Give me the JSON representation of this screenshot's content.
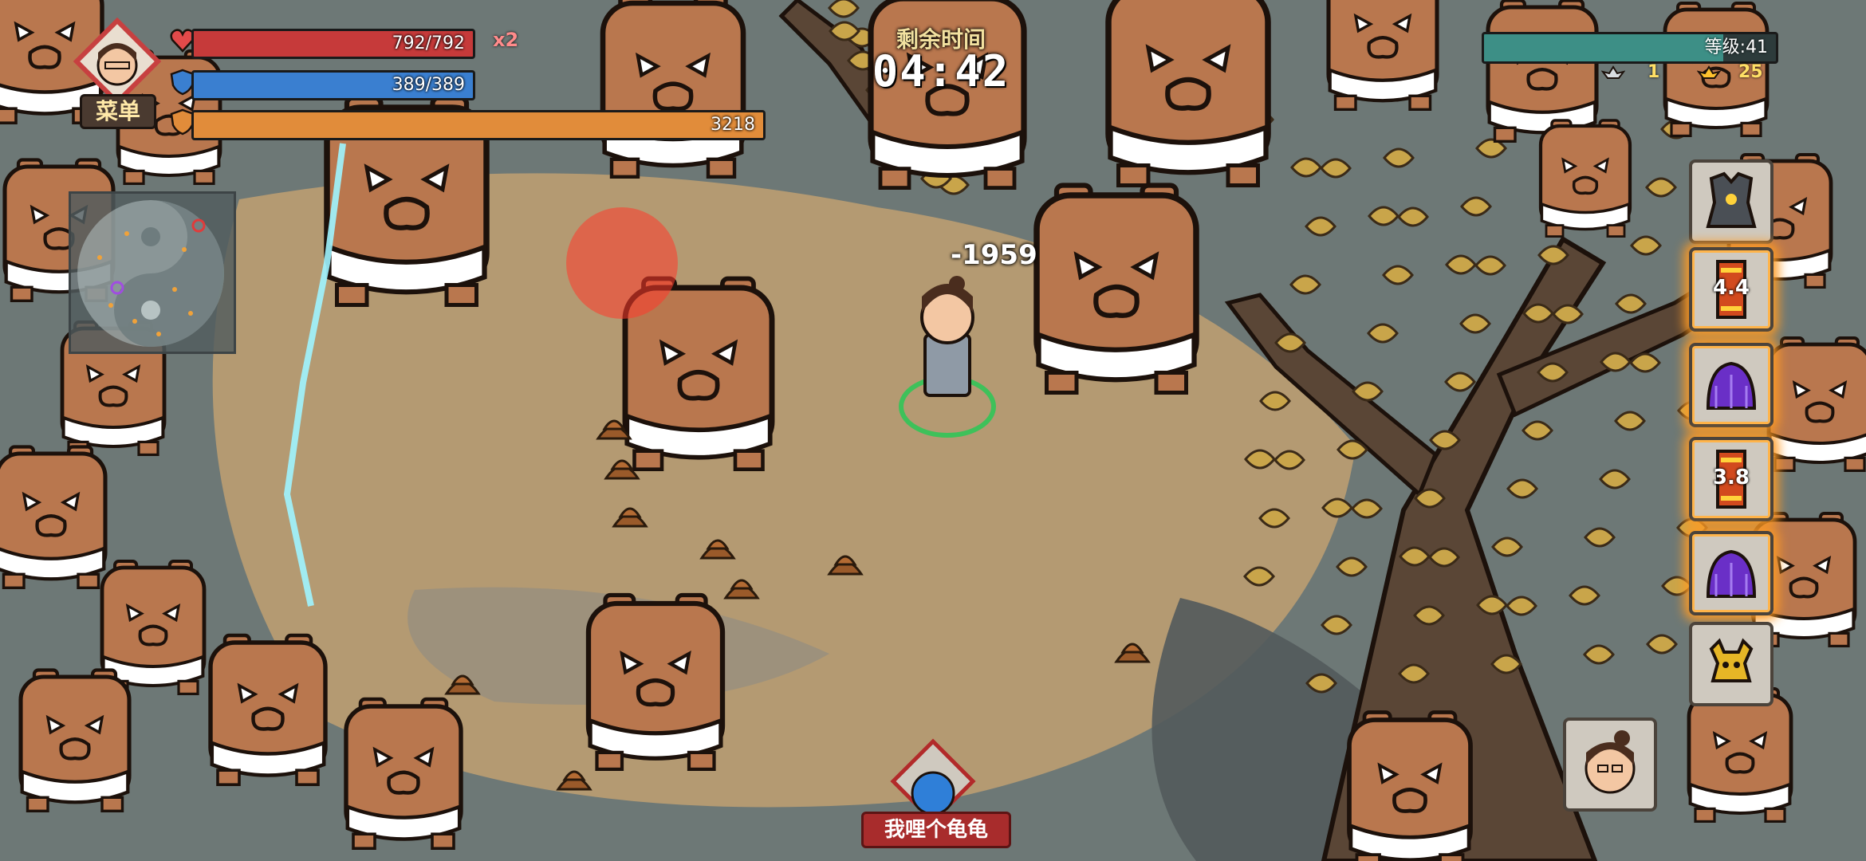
{
  "hud": {
    "health": {
      "current": 792,
      "max": 792,
      "text": "792/792",
      "fraction": 1.0,
      "color": "#c63a3a",
      "icon": "heart-icon"
    },
    "multiplier": "x2",
    "shield": {
      "current": 389,
      "max": 389,
      "text": "389/389",
      "fraction": 1.0,
      "color": "#3a7fd0",
      "icon": "shield-icon"
    },
    "experience": {
      "text": "3218",
      "fraction": 1.0,
      "color": "#e18c3a",
      "icon": "armor-icon"
    },
    "menu_label": "菜单",
    "timer_label": "剩余时间",
    "timer_value": "04:42",
    "level_text": "等级:41",
    "level_fraction": 0.82,
    "silver_count": "1",
    "gold_count": "25",
    "damage_number": "-1959"
  },
  "skills": [
    {
      "name": "armor-skill-icon",
      "text": "",
      "glow": false
    },
    {
      "name": "scroll-skill-icon",
      "text": "4.4",
      "glow": true
    },
    {
      "name": "purple-dome-skill-icon",
      "text": "",
      "glow": true
    },
    {
      "name": "scroll-skill-icon",
      "text": "3.8",
      "glow": true
    },
    {
      "name": "purple-dome-skill-icon",
      "text": "",
      "glow": true
    },
    {
      "name": "horned-skill-icon",
      "text": "",
      "glow": false
    }
  ],
  "bottom": {
    "chat_tag": "我哩个龟龟"
  },
  "colors": {
    "enemy_body": "#b9774e",
    "enemy_outline": "#1c110b",
    "ground": "#b49a72",
    "shadow": "#525a5c",
    "tree_leaf": "#c9a54a"
  }
}
